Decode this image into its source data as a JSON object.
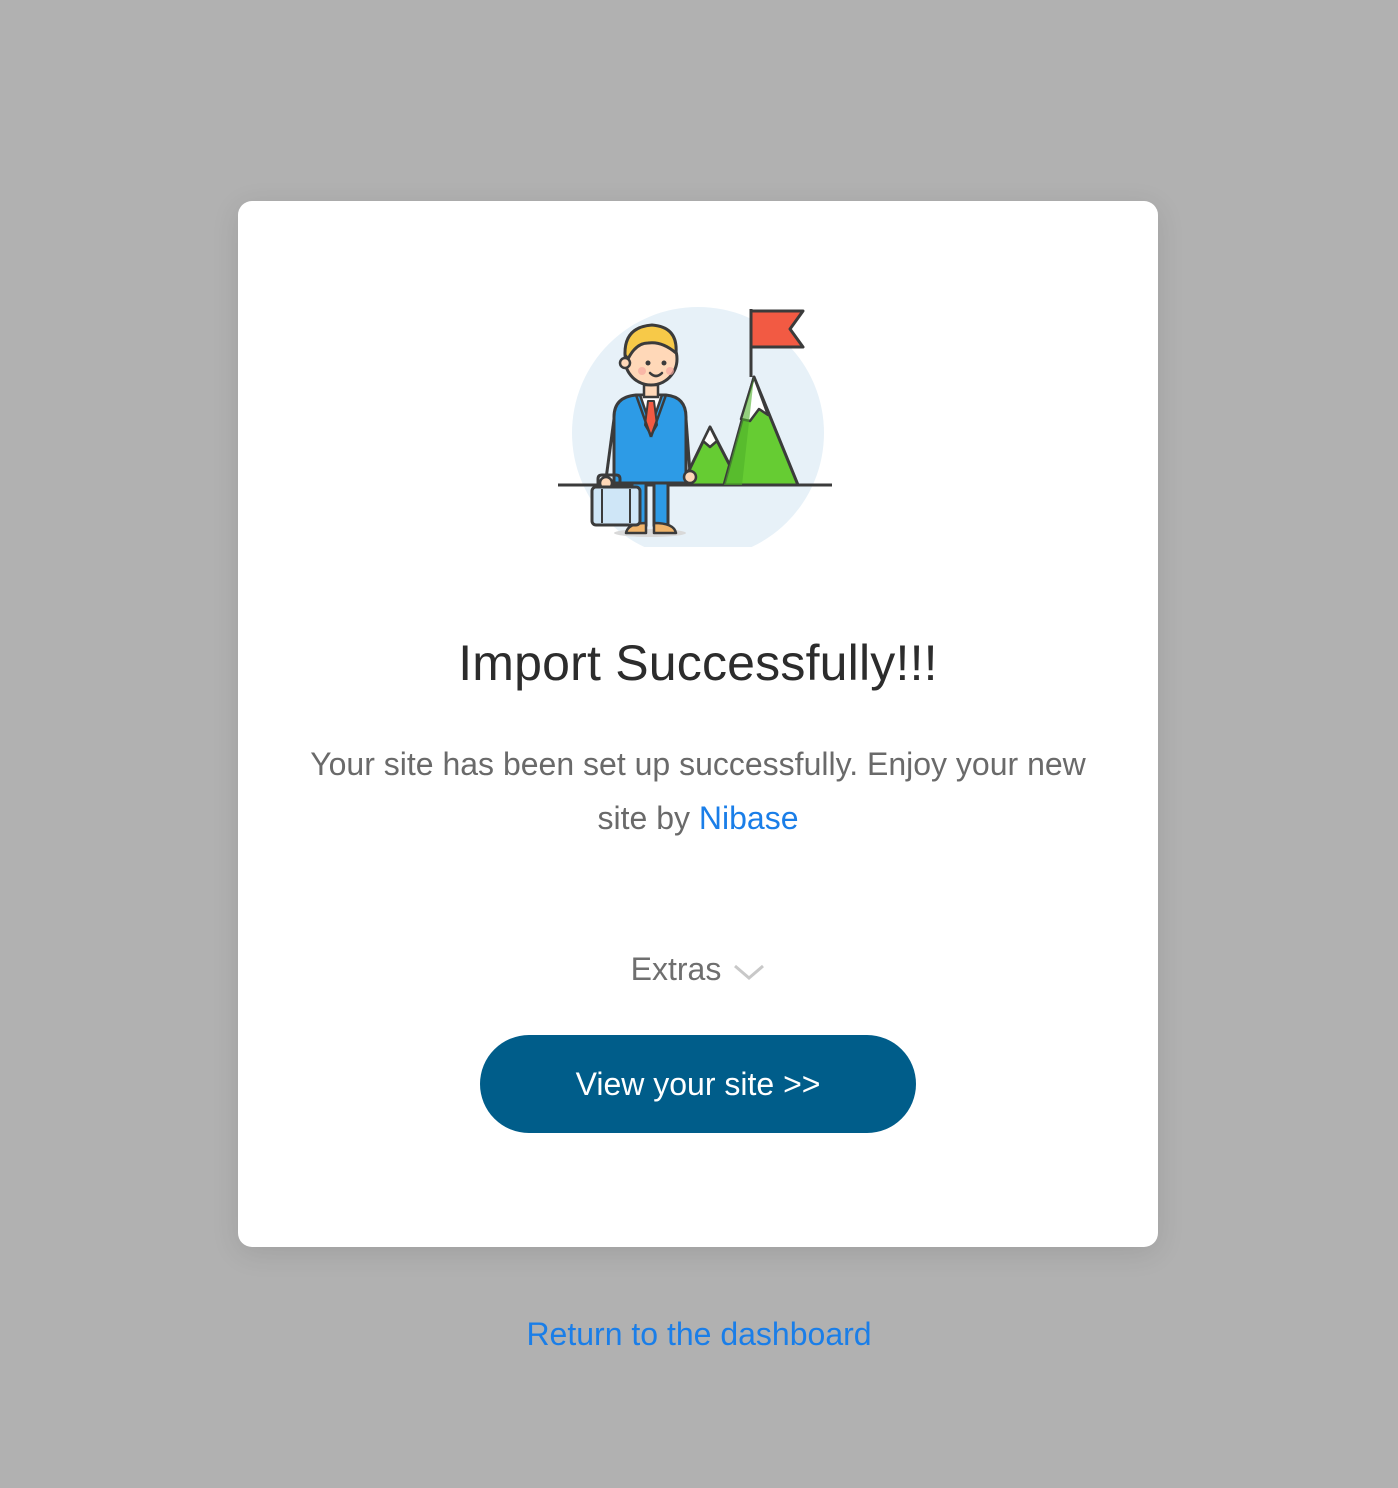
{
  "card": {
    "title": "Import Successfully!!!",
    "message_prefix": "Your site has been set up successfully. Enjoy your new site by",
    "brand_link": "Nibase",
    "extras_label": "Extras",
    "extras_icon": "chevron-down-icon",
    "illustration": "businessman-mountain-flag-illustration",
    "view_button_label": "View your site >>"
  },
  "footer": {
    "return_link": "Return to the dashboard"
  },
  "colors": {
    "background": "#b1b1b1",
    "card": "#ffffff",
    "button": "#005d8a",
    "link": "#1a7ee8",
    "title": "#2c2c2c",
    "body_text": "#6a6a6a"
  }
}
